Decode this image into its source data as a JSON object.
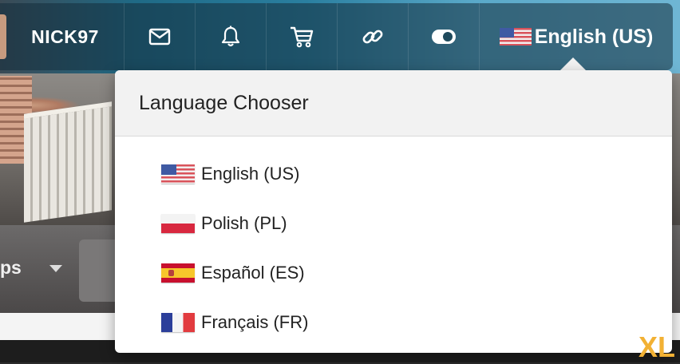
{
  "navbar": {
    "username": "NICK97",
    "icons": [
      "mail-icon",
      "bell-icon",
      "cart-icon",
      "link-icon",
      "toggle-icon"
    ],
    "language_current": "English (US)",
    "language_flag": "us-flag-icon"
  },
  "nav2": {
    "partial_label": "ps"
  },
  "language_chooser": {
    "title": "Language Chooser",
    "options": [
      {
        "label": "English (US)",
        "flag": "us-flag-icon"
      },
      {
        "label": "Polish (PL)",
        "flag": "pl-flag-icon"
      },
      {
        "label": "Español (ES)",
        "flag": "es-flag-icon"
      },
      {
        "label": "Français (FR)",
        "flag": "fr-flag-icon"
      }
    ]
  },
  "watermark": "XL",
  "colors": {
    "navbar_bg": "#1f4a5c",
    "dropdown_header_bg": "#f2f2f2",
    "text_dark": "#222222",
    "watermark": "#f2b134"
  }
}
